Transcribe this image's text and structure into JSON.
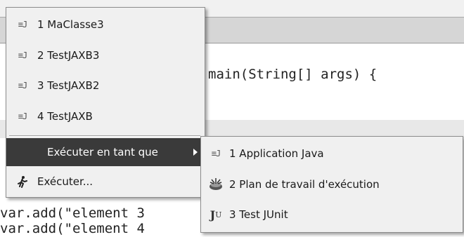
{
  "editor": {
    "code": [
      "main(String[] args) {",
      "var.add(\"element 3",
      "var.add(\"element 4"
    ]
  },
  "run_menu": {
    "history": [
      {
        "label": "1 MaClasse3",
        "icon": "java-class-icon"
      },
      {
        "label": "2 TestJAXB3",
        "icon": "java-class-icon"
      },
      {
        "label": "3 TestJAXB2",
        "icon": "java-class-icon"
      },
      {
        "label": "4 TestJAXB",
        "icon": "java-class-icon"
      }
    ],
    "run_as_label": "Exécuter en tant que",
    "run_label": "Exécuter...",
    "run_icon": "run-figure-icon"
  },
  "run_as_submenu": {
    "items": [
      {
        "label": "1 Application Java",
        "icon": "java-class-icon"
      },
      {
        "label": "2 Plan de travail d'exécution",
        "icon": "workbench-icon"
      },
      {
        "label": "3 Test JUnit",
        "icon": "junit-icon"
      }
    ]
  },
  "colors": {
    "menu_bg": "#f0f0f0",
    "selection": "#3a3a3a"
  }
}
